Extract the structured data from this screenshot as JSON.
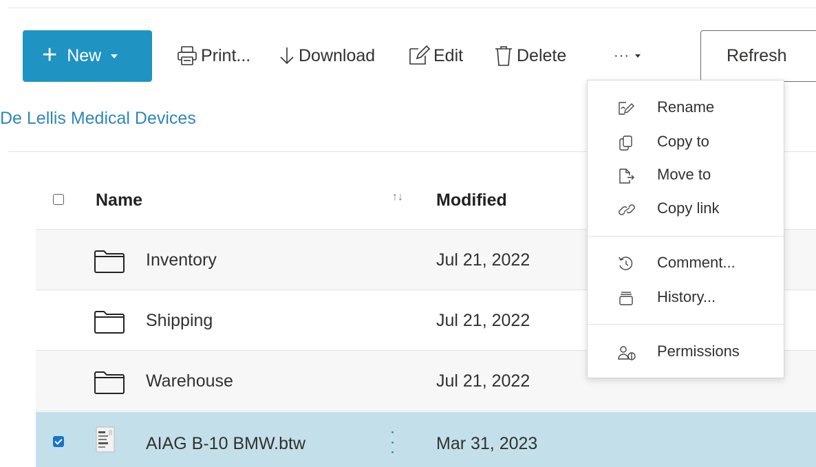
{
  "toolbar": {
    "new_label": "New",
    "print_label": "Print...",
    "download_label": "Download",
    "edit_label": "Edit",
    "delete_label": "Delete",
    "more_label": "···",
    "refresh_label": "Refresh"
  },
  "breadcrumb": "De Lellis Medical Devices",
  "table": {
    "columns": [
      "Name",
      "Modified"
    ],
    "sort_glyph": "↑↓",
    "rows": [
      {
        "name": "Inventory",
        "modified": "Jul 21, 2022",
        "type": "folder",
        "selected": false
      },
      {
        "name": "Shipping",
        "modified": "Jul 21, 2022",
        "type": "folder",
        "selected": false
      },
      {
        "name": "Warehouse",
        "modified": "Jul 21, 2022",
        "type": "folder",
        "selected": false
      },
      {
        "name": "AIAG B-10 BMW.btw",
        "modified": "Mar 31, 2023",
        "type": "file",
        "selected": true
      }
    ]
  },
  "menu": {
    "items": [
      {
        "label": "Rename",
        "icon": "rename-icon"
      },
      {
        "label": "Copy to",
        "icon": "copy-icon"
      },
      {
        "label": "Move to",
        "icon": "move-icon"
      },
      {
        "label": "Copy link",
        "icon": "link-icon"
      },
      {
        "label": "Comment...",
        "icon": "history-comment-icon"
      },
      {
        "label": "History...",
        "icon": "history-icon"
      },
      {
        "label": "Permissions",
        "icon": "permissions-icon"
      }
    ]
  },
  "colors": {
    "accent": "#1f93c2",
    "link": "#2f87b5",
    "selected_row": "#c3e0ea",
    "checkbox": "#1a73c9"
  }
}
